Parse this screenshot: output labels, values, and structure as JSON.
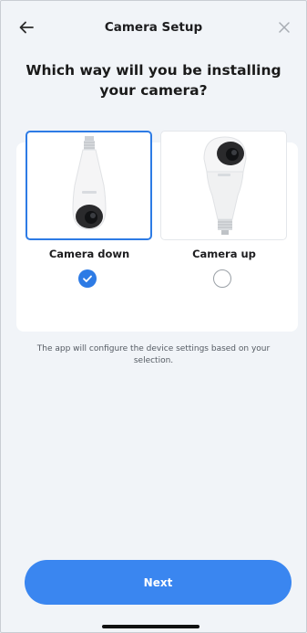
{
  "header": {
    "title": "Camera Setup",
    "back_icon": "arrow-left-icon",
    "close_icon": "close-icon"
  },
  "question": "Which way will you be installing your camera?",
  "options": [
    {
      "label": "Camera down",
      "selected": true,
      "icon": "camera-bulb-down-icon"
    },
    {
      "label": "Camera up",
      "selected": false,
      "icon": "camera-bulb-up-icon"
    }
  ],
  "note": "The app will configure the device settings based on your selection.",
  "next_label": "Next",
  "colors": {
    "accent": "#3a86f0",
    "background": "#f1f4f8",
    "card": "#ffffff"
  }
}
